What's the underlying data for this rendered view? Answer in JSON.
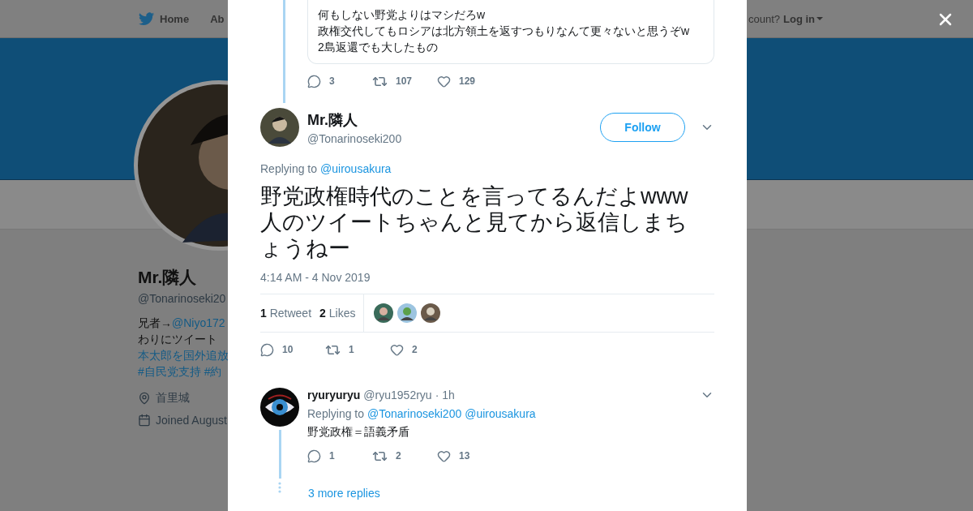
{
  "nav": {
    "items": [
      {
        "label": "Home",
        "kind": "home"
      },
      {
        "label": "Ab",
        "kind": "plain"
      }
    ],
    "account_prompt": "count?",
    "login": "Log in"
  },
  "profile": {
    "name": "Mr.隣人",
    "handle": "@Tonarinoseki20",
    "bio": [
      [
        {
          "text": "兄者→",
          "kind": "text"
        },
        {
          "text": "@Niyo172",
          "kind": "link"
        }
      ],
      [
        {
          "text": "わりにツイート",
          "kind": "text"
        }
      ],
      [
        {
          "text": "本太郎を国外追放",
          "kind": "link"
        }
      ],
      [
        {
          "text": "#自民党支持 #約",
          "kind": "link"
        }
      ]
    ],
    "location": "首里城",
    "joined": "Joined August"
  },
  "quoted": {
    "lines": [
      "何もしない野党よりはマシだろw",
      "政権交代してもロシアは北方領土を返すつもりなんて更々ないと思うぞw",
      "2島返還でも大したもの"
    ],
    "replies": "3",
    "retweets": "107",
    "likes": "129"
  },
  "tweet": {
    "name": "Mr.隣人",
    "handle": "@Tonarinoseki200",
    "follow": "Follow",
    "replying_label": "Replying to",
    "replying_to": [
      "@uirousakura"
    ],
    "text": [
      "野党政権時代のことを言ってるんだよwww",
      "人のツイートちゃんと見てから返信しまちょうねー"
    ],
    "timestamp": "4:14 AM - 4 Nov 2019",
    "retweet_count": "1",
    "retweet_label": "Retweet",
    "like_count": "2",
    "like_label": "Likes",
    "replies": "10",
    "retweets": "1",
    "likes": "2"
  },
  "reply": {
    "name": "ryuryuryu",
    "handle": "@ryu1952ryu",
    "time": "· 1h",
    "replying_label": "Replying to",
    "replying_to": [
      "@Tonarinoseki200",
      "@uirousakura"
    ],
    "text": "野党政権＝語義矛盾",
    "replies": "1",
    "retweets": "2",
    "likes": "13",
    "more": "3 more replies"
  }
}
